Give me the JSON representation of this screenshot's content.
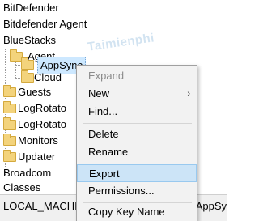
{
  "tree": {
    "items": [
      {
        "label": "BitDefender"
      },
      {
        "label": "Bitdefender Agent"
      },
      {
        "label": "BlueStacks"
      },
      {
        "label": "Agent"
      },
      {
        "label": "AppSync"
      },
      {
        "label": "Cloud"
      },
      {
        "label": "Guests"
      },
      {
        "label": "LogRotato"
      },
      {
        "label": "LogRotato"
      },
      {
        "label": "Monitors"
      },
      {
        "label": "Updater"
      },
      {
        "label": "Broadcom"
      },
      {
        "label": "Classes"
      }
    ]
  },
  "statusbar": {
    "path_left": "LOCAL_MACHI",
    "path_right": "\\AppSy"
  },
  "context_menu": {
    "expand": "Expand",
    "new": "New",
    "find": "Find...",
    "delete": "Delete",
    "rename": "Rename",
    "export": "Export",
    "permissions": "Permissions...",
    "copy_key_name": "Copy Key Name",
    "submenu_arrow": "›"
  },
  "watermark": "Taimienphi",
  "colors": {
    "highlight": "#cce4f7",
    "selected": "#cde8ff",
    "folder": "#f3d37c"
  }
}
